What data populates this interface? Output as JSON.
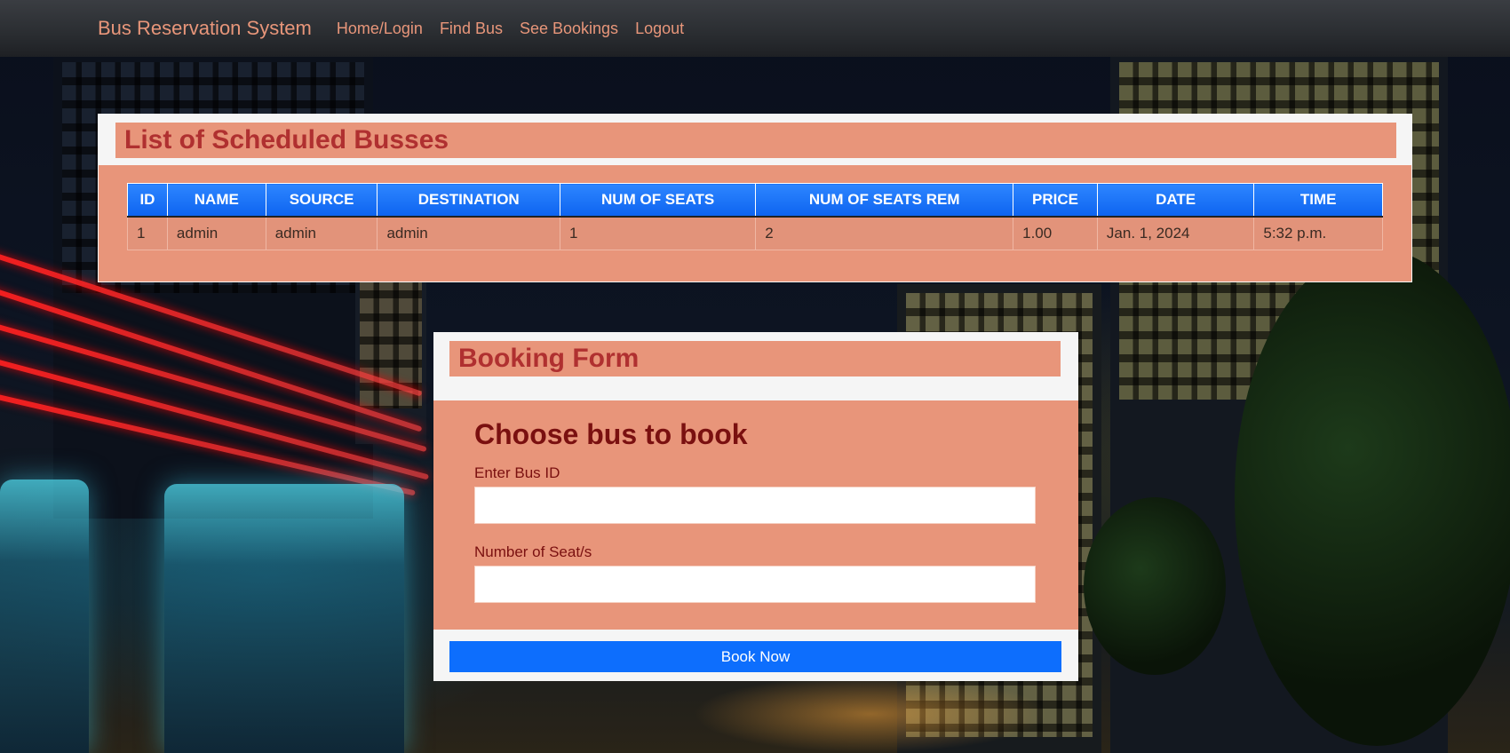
{
  "navbar": {
    "brand": "Bus Reservation System",
    "links": [
      "Home/Login",
      "Find Bus",
      "See Bookings",
      "Logout"
    ]
  },
  "schedule": {
    "title": "List of Scheduled Busses",
    "columns": [
      "ID",
      "NAME",
      "SOURCE",
      "DESTINATION",
      "NUM OF SEATS",
      "NUM OF SEATS REM",
      "PRICE",
      "DATE",
      "TIME"
    ],
    "rows": [
      [
        "1",
        "admin",
        "admin",
        "admin",
        "1",
        "2",
        "1.00",
        "Jan. 1, 2024",
        "5:32 p.m."
      ]
    ]
  },
  "booking": {
    "title": "Booking Form",
    "subtitle": "Choose bus to book",
    "bus_id_label": "Enter Bus ID",
    "bus_id_value": "",
    "seats_label": "Number of Seat/s",
    "seats_value": "",
    "submit_label": "Book Now"
  },
  "colors": {
    "panel": "#e8957a",
    "title_text": "#b03030",
    "header_blue": "#0d6efd",
    "nav_text": "#e8967a"
  }
}
